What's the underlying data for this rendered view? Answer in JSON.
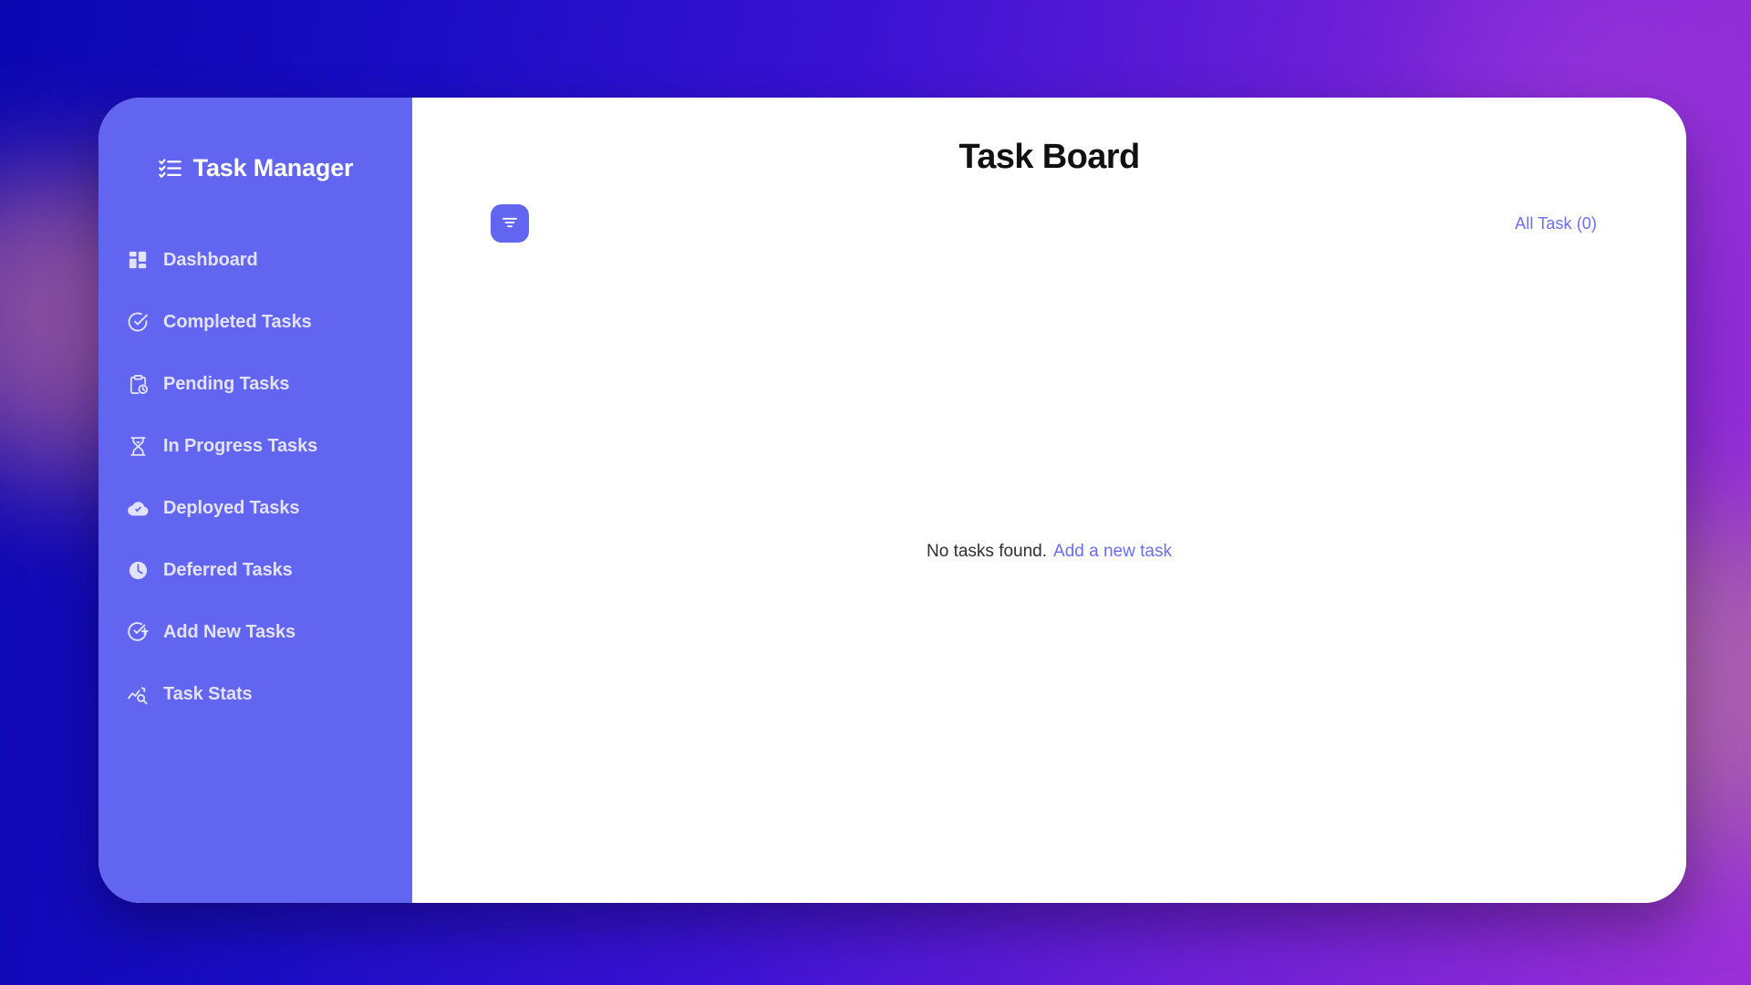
{
  "background": {
    "gradient_from": "#0a06b0",
    "gradient_to": "#9b2fd8",
    "accent_blob": "#c4729d"
  },
  "theme": {
    "sidebar_bg": "#6265ef",
    "accent": "#6b6ef2",
    "card_bg": "#ffffff",
    "title_color": "#111114",
    "nav_label_color": "#e3e2fb"
  },
  "sidebar": {
    "brand": {
      "title": "Task Manager",
      "icon": "checklist-icon"
    },
    "items": [
      {
        "label": "Dashboard",
        "icon": "dashboard-grid-icon"
      },
      {
        "label": "Completed Tasks",
        "icon": "circle-check-icon"
      },
      {
        "label": "Pending Tasks",
        "icon": "clipboard-clock-icon"
      },
      {
        "label": "In Progress Tasks",
        "icon": "hourglass-icon"
      },
      {
        "label": "Deployed Tasks",
        "icon": "cloud-check-icon"
      },
      {
        "label": "Deferred Tasks",
        "icon": "clock-icon"
      },
      {
        "label": "Add New Tasks",
        "icon": "circle-check-plus-icon"
      },
      {
        "label": "Task Stats",
        "icon": "chart-search-icon"
      }
    ]
  },
  "main": {
    "title": "Task Board",
    "toolbar": {
      "filter_icon": "filter-funnel-icon",
      "filter_label": "Filter",
      "all_task_label": "All Task (0)",
      "task_count": 0
    },
    "empty_state": {
      "message": "No tasks found.",
      "link_label": "Add a new task"
    }
  }
}
